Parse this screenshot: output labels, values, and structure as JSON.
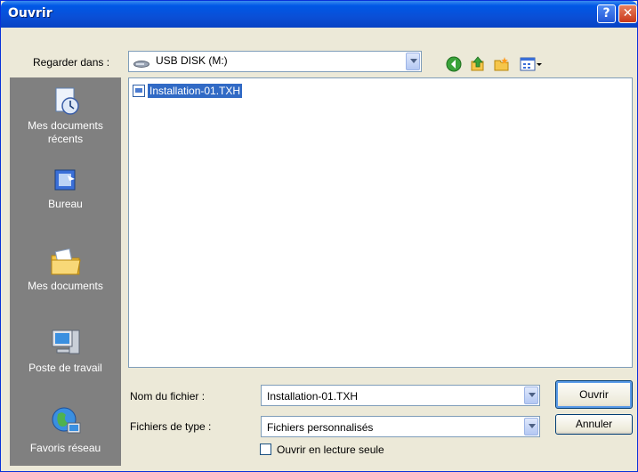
{
  "window": {
    "title": "Ouvrir",
    "help_label": "?",
    "close_label": "✕"
  },
  "toolbar": {
    "look_in_label": "Regarder dans :",
    "look_in_value": "USB DISK (M:)",
    "icons": [
      "back-icon",
      "up-folder-icon",
      "new-folder-icon",
      "view-menu-icon"
    ]
  },
  "places": [
    {
      "label": "Mes documents récents",
      "icon": "recent-documents-icon"
    },
    {
      "label": "Bureau",
      "icon": "desktop-icon"
    },
    {
      "label": "Mes documents",
      "icon": "my-documents-icon"
    },
    {
      "label": "Poste de travail",
      "icon": "my-computer-icon"
    },
    {
      "label": "Favoris réseau",
      "icon": "network-places-icon"
    }
  ],
  "files": [
    {
      "name": "Installation-01.TXH",
      "selected": true
    }
  ],
  "form": {
    "filename_label": "Nom du fichier :",
    "filename_value": "Installation-01.TXH",
    "filetype_label": "Fichiers de type :",
    "filetype_value": "Fichiers personnalisés",
    "readonly_label": "Ouvrir en lecture seule",
    "readonly_checked": false
  },
  "buttons": {
    "open": "Ouvrir",
    "cancel": "Annuler"
  }
}
